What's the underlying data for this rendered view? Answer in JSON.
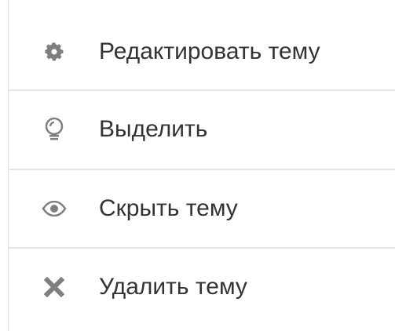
{
  "menu": {
    "items": [
      {
        "label": "Редактировать тему",
        "icon": "gear-icon"
      },
      {
        "label": "Выделить",
        "icon": "lightbulb-icon"
      },
      {
        "label": "Скрыть тему",
        "icon": "eye-icon"
      },
      {
        "label": "Удалить тему",
        "icon": "close-icon"
      }
    ]
  },
  "colors": {
    "icon": "#7f7f7f",
    "text": "#333333",
    "divider": "#e6e6e6",
    "border": "#e3e3e3"
  }
}
